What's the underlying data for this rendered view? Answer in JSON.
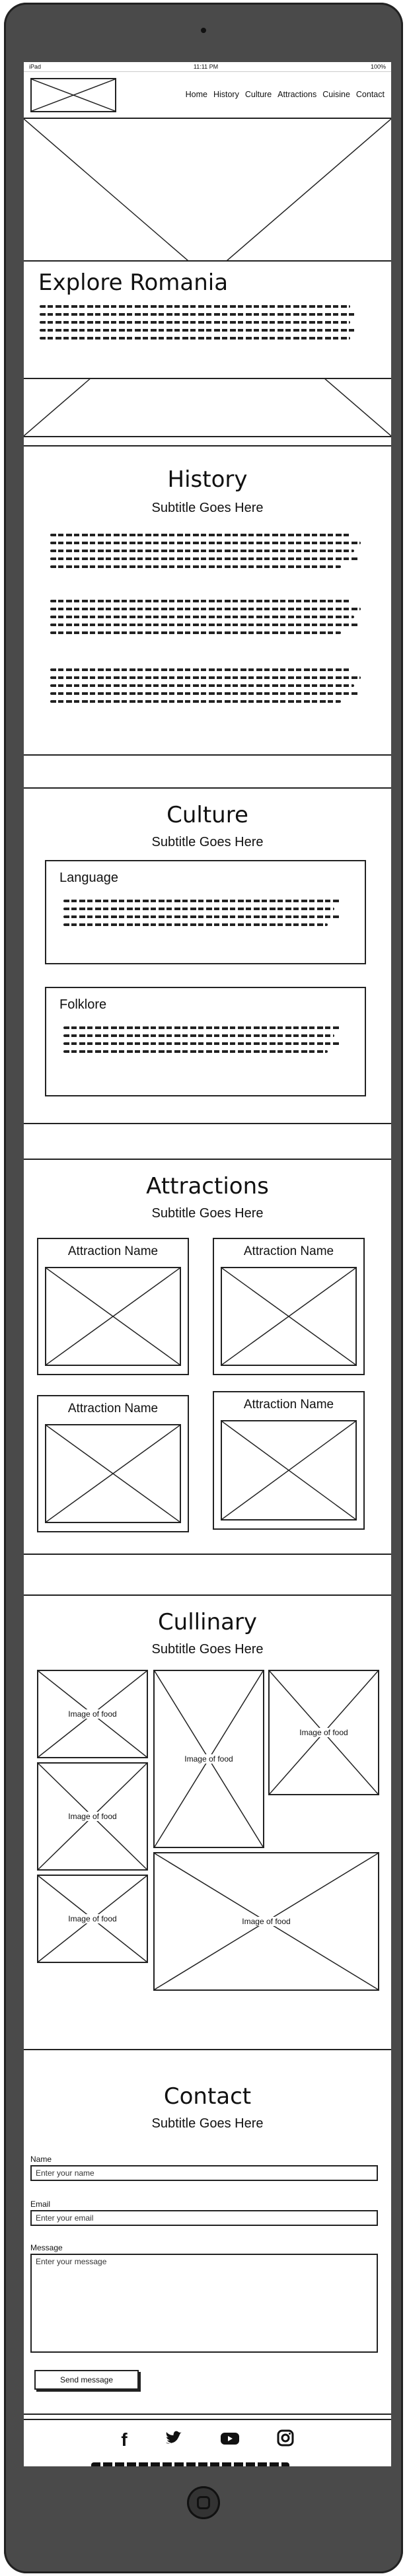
{
  "status_bar": {
    "device": "iPad",
    "time": "11:11 PM",
    "battery": "100%"
  },
  "nav": {
    "items": [
      "Home",
      "History",
      "Culture",
      "Attractions",
      "Cuisine",
      "Contact"
    ]
  },
  "hero": {
    "title": "Explore Romania"
  },
  "history": {
    "title": "History",
    "subtitle": "Subtitle Goes Here"
  },
  "culture": {
    "title": "Culture",
    "subtitle": "Subtitle Goes Here",
    "cards": [
      {
        "title": "Language"
      },
      {
        "title": "Folklore"
      }
    ]
  },
  "attractions": {
    "title": "Attractions",
    "subtitle": "Subtitle Goes Here",
    "cards": [
      {
        "title": "Attraction Name"
      },
      {
        "title": "Attraction Name"
      },
      {
        "title": "Attraction Name"
      },
      {
        "title": "Attraction Name"
      }
    ]
  },
  "culinary": {
    "title": "Cullinary",
    "subtitle": "Subtitle Goes Here",
    "image_label": "Image of food"
  },
  "contact": {
    "title": "Contact",
    "subtitle": "Subtitle Goes Here",
    "name_label": "Name",
    "name_placeholder": "Enter your name",
    "email_label": "Email",
    "email_placeholder": "Enter your email",
    "message_label": "Message",
    "message_placeholder": "Enter your message",
    "send_label": "Send message"
  },
  "footer": {
    "icons": [
      "facebook-icon",
      "twitter-icon",
      "youtube-icon",
      "instagram-icon"
    ]
  }
}
